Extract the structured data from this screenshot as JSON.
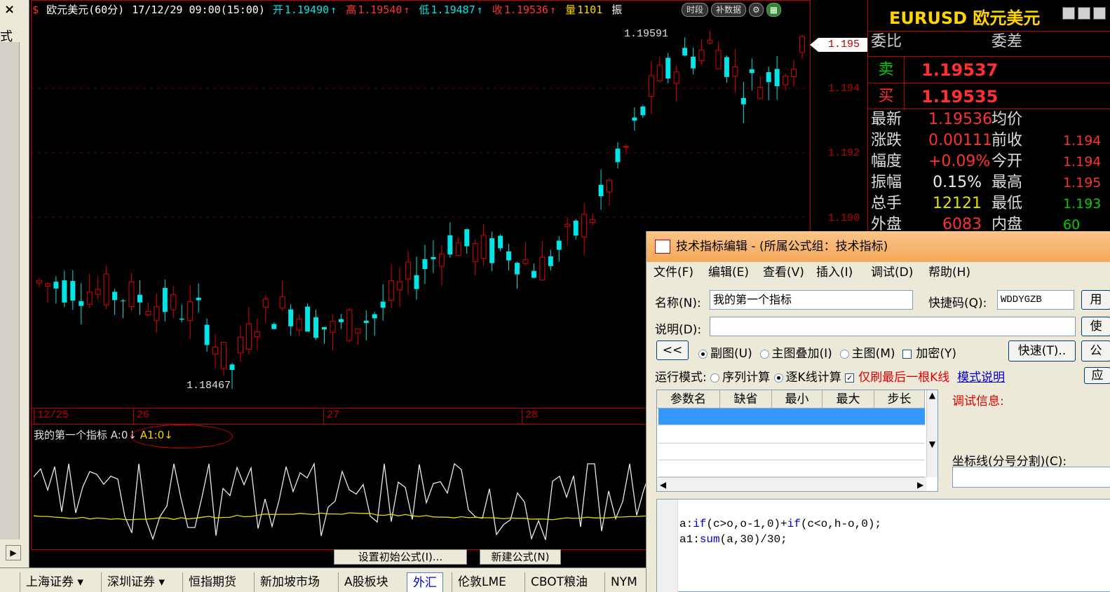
{
  "left_panel": {
    "close": "×",
    "label": "式",
    "scroll_arrow": "▶"
  },
  "chart_title": {
    "symbol_icon": "$",
    "name": "欧元美元(60分)",
    "datetime": "17/12/29 09:00(15:00)",
    "open_label": "开",
    "open": "1.19490",
    "high_label": "高",
    "high": "1.19540",
    "low_label": "低",
    "low": "1.19487",
    "close_label": "收",
    "close": "1.19536",
    "vol_label": "量",
    "vol": "1101",
    "amp_label": "振",
    "arrow": "↑"
  },
  "tags": {
    "period": "时段",
    "supplement": "补数据"
  },
  "annotations": {
    "high_price": "1.19591",
    "low_price": "1.18467"
  },
  "price_axis": {
    "labels": [
      "1.194",
      "1.192",
      "1.190"
    ],
    "current": "1.195"
  },
  "date_labels": [
    "12/25",
    "26",
    "27",
    "28"
  ],
  "indicator": {
    "name": "我的第一个指标",
    "a": "A:0",
    "a1": "A1:0",
    "arrow": "↓"
  },
  "buttons": {
    "set_initial": "设置初始公式(I)...",
    "new_formula": "新建公式(N)"
  },
  "bottom_tabs": [
    "上海证券 ▾",
    "深圳证券 ▾",
    "恒指期货",
    "新加坡市场",
    "A股板块",
    "外汇",
    "伦敦LME",
    "CBOT粮油",
    "NYM"
  ],
  "quote": {
    "code": "EURUSD",
    "name": "欧元美元",
    "weibi": "委比",
    "weicha": "委差",
    "sell_label": "卖",
    "sell": "1.19537",
    "buy_label": "买",
    "buy": "1.19535",
    "rows": [
      {
        "l1": "最新",
        "v1": "1.19536",
        "l2": "均价",
        "v2": ""
      },
      {
        "l1": "涨跌",
        "v1": "0.00111",
        "l2": "前收",
        "v2": "1.194"
      },
      {
        "l1": "幅度",
        "v1": "+0.09%",
        "l2": "今开",
        "v2": "1.194"
      },
      {
        "l1": "振幅",
        "v1": "0.15%",
        "l2": "最高",
        "v2": "1.195"
      },
      {
        "l1": "总手",
        "v1": "12121",
        "l2": "最低",
        "v2": "1.193"
      },
      {
        "l1": "外盘",
        "v1": "6083",
        "l2": "内盘",
        "v2": "60"
      }
    ]
  },
  "dialog": {
    "title": "技术指标编辑 - (所属公式组：技术指标)",
    "menu": [
      "文件(F)",
      "编辑(E)",
      "查看(V)",
      "插入(I)",
      "调试(D)",
      "帮助(H)"
    ],
    "name_label": "名称(N):",
    "name_value": "我的第一个指标",
    "shortcut_label": "快捷码(Q):",
    "shortcut_value": "WDDYGZB",
    "desc_label": "说明(D):",
    "desc_value": "",
    "back_btn": "<<",
    "opt_sub": "副图(U)",
    "opt_overlay": "主图叠加(I)",
    "opt_main": "主图(M)",
    "opt_encrypt": "加密(Y)",
    "quick_btn": "快速(T)..",
    "run_mode_label": "运行模式:",
    "run_seq": "序列计算",
    "run_each": "逐K线计算",
    "only_last": "仅刷最后一根K线",
    "mode_help": "模式说明",
    "param_headers": [
      "参数名",
      "缺省",
      "最小",
      "最大",
      "步长"
    ],
    "debug_label": "调试信息:",
    "coord_label": "坐标线(分号分割)(C):",
    "right_btns": [
      "用",
      "使",
      "公",
      "应"
    ],
    "code_lines": [
      [
        "a:",
        "if",
        "(c>o,o-1,0)+",
        "if",
        "(c<o,h-o,0);"
      ],
      [
        "a1:",
        "sum",
        "(a,30)/30;"
      ]
    ]
  },
  "colors": {
    "up": "#e00000",
    "down": "#00e5e5",
    "frame": "#c00000",
    "ma": "#e0e000"
  }
}
